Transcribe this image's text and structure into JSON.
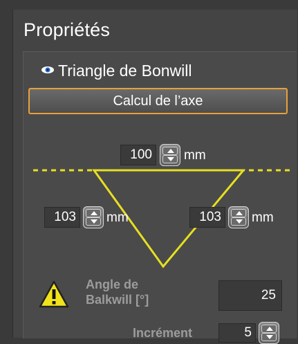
{
  "panel": {
    "title": "Propriétés"
  },
  "section": {
    "title": "Triangle de Bonwill",
    "visibility_icon": "eye-icon",
    "calc_button": "Calcul de l’axe"
  },
  "triangle": {
    "top_value": "100",
    "top_unit": "mm",
    "left_value": "103",
    "left_unit": "mm",
    "right_value": "103",
    "right_unit": "mm",
    "line_color": "#e6e020"
  },
  "angle": {
    "warning_icon": "warning-triangle-icon",
    "label": "Angle de Balkwill [°]",
    "value": "25"
  },
  "increment": {
    "label": "Incrément",
    "value": "5"
  },
  "colors": {
    "accent": "#e8a23a",
    "triangle": "#e6e020"
  }
}
